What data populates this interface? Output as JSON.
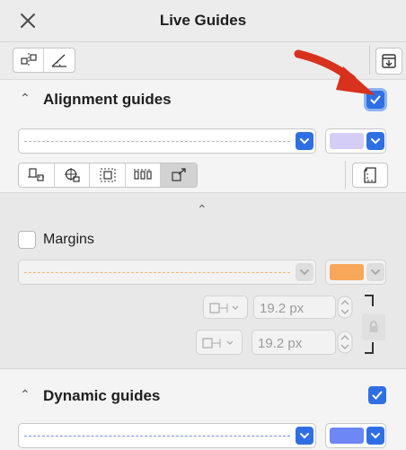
{
  "window": {
    "title": "Live Guides"
  },
  "alignment": {
    "heading": "Alignment guides",
    "checked": true,
    "color": "#d4cdf5"
  },
  "margins": {
    "label": "Margins",
    "checked": false,
    "color": "#f8a65a",
    "line_color": "#f2b270",
    "offset_1": "19.2 px",
    "offset_2": "19.2 px"
  },
  "dynamic": {
    "heading": "Dynamic guides",
    "checked": true,
    "color": "#6e87f6",
    "line_color": "#6f8ee8"
  },
  "annotation": {
    "arrow_color": "#d8321e"
  }
}
